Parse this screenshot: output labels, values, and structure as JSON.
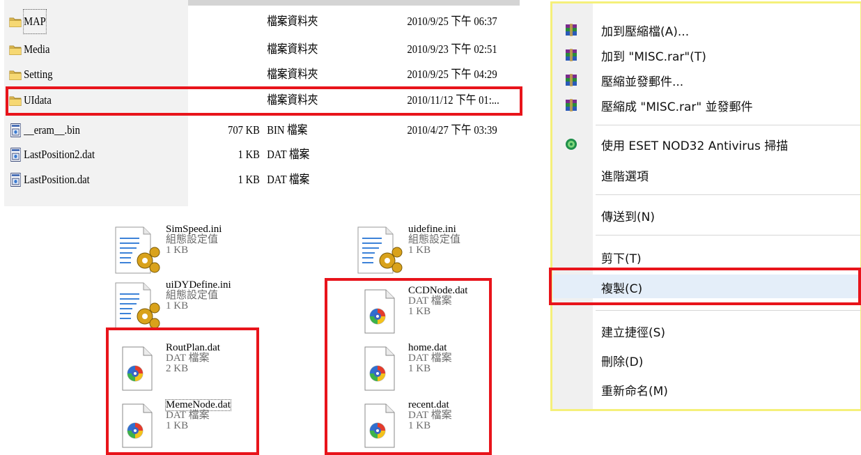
{
  "file_list": {
    "rows": [
      {
        "name": "MAP",
        "size": "",
        "type": "檔案資料夾",
        "date": "2010/9/25 下午 06:37",
        "icon": "folder-icon"
      },
      {
        "name": "Media",
        "size": "",
        "type": "檔案資料夾",
        "date": "2010/9/23 下午 02:51",
        "icon": "folder-icon"
      },
      {
        "name": "Setting",
        "size": "",
        "type": "檔案資料夾",
        "date": "2010/9/25 下午 04:29",
        "icon": "folder-icon"
      },
      {
        "name": "UIdata",
        "size": "",
        "type": "檔案資料夾",
        "date": "2010/11/12 下午 01:...",
        "icon": "folder-icon"
      },
      {
        "name": "__eram__.bin",
        "size": "707 KB",
        "type": "BIN 檔案",
        "date": "2010/4/27 下午 03:39",
        "icon": "file-icon"
      },
      {
        "name": "LastPosition2.dat",
        "size": "1 KB",
        "type": "DAT 檔案",
        "date": "",
        "icon": "file-icon"
      },
      {
        "name": "LastPosition.dat",
        "size": "1 KB",
        "type": "DAT 檔案",
        "date": "",
        "icon": "file-icon"
      }
    ]
  },
  "thumbnails": [
    {
      "name": "SimSpeed.ini",
      "type": "組態設定值",
      "size": "1 KB",
      "icon": "ini-settings-icon"
    },
    {
      "name": "uidefine.ini",
      "type": "組態設定值",
      "size": "1 KB",
      "icon": "ini-settings-icon"
    },
    {
      "name": "uiDYDefine.ini",
      "type": "組態設定值",
      "size": "1 KB",
      "icon": "ini-settings-icon"
    },
    {
      "name": "CCDNode.dat",
      "type": "DAT 檔案",
      "size": "1 KB",
      "icon": "media-file-icon"
    },
    {
      "name": "RoutPlan.dat",
      "type": "DAT 檔案",
      "size": "2 KB",
      "icon": "media-file-icon"
    },
    {
      "name": "home.dat",
      "type": "DAT 檔案",
      "size": "1 KB",
      "icon": "media-file-icon"
    },
    {
      "name": "MemeNode.dat",
      "type": "DAT 檔案",
      "size": "1 KB",
      "icon": "media-file-icon"
    },
    {
      "name": "recent.dat",
      "type": "DAT 檔案",
      "size": "1 KB",
      "icon": "media-file-icon"
    }
  ],
  "context_menu": {
    "items": [
      {
        "label": "加到壓縮檔(A)...",
        "icon": "winrar-icon"
      },
      {
        "label": "加到 \"MISC.rar\"(T)",
        "icon": "winrar-icon"
      },
      {
        "label": "壓縮並發郵件...",
        "icon": "winrar-icon"
      },
      {
        "label": "壓縮成 \"MISC.rar\" 並發郵件",
        "icon": "winrar-icon"
      },
      {
        "label": "使用 ESET NOD32 Antivirus 掃描",
        "icon": "eset-icon"
      },
      {
        "label": "進階選項",
        "icon": ""
      },
      {
        "label": "傳送到(N)",
        "icon": ""
      },
      {
        "label": "剪下(T)",
        "icon": ""
      },
      {
        "label": "複製(C)",
        "icon": ""
      },
      {
        "label": "建立捷徑(S)",
        "icon": ""
      },
      {
        "label": "刪除(D)",
        "icon": ""
      },
      {
        "label": "重新命名(M)",
        "icon": ""
      }
    ]
  },
  "colors": {
    "highlight_red": "#e8141b",
    "menu_border_yellow": "#f5f07a",
    "menu_hover": "#e4eef9"
  }
}
